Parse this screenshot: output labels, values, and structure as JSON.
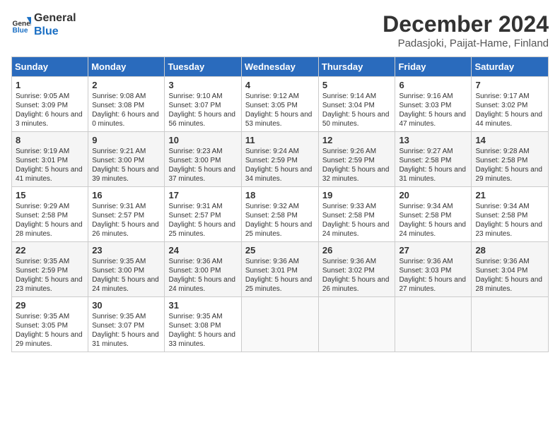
{
  "header": {
    "logo_line1": "General",
    "logo_line2": "Blue",
    "title": "December 2024",
    "subtitle": "Padasjoki, Paijat-Hame, Finland"
  },
  "weekdays": [
    "Sunday",
    "Monday",
    "Tuesday",
    "Wednesday",
    "Thursday",
    "Friday",
    "Saturday"
  ],
  "weeks": [
    [
      {
        "day": "1",
        "info": "Sunrise: 9:05 AM\nSunset: 3:09 PM\nDaylight: 6 hours and 3 minutes."
      },
      {
        "day": "2",
        "info": "Sunrise: 9:08 AM\nSunset: 3:08 PM\nDaylight: 6 hours and 0 minutes."
      },
      {
        "day": "3",
        "info": "Sunrise: 9:10 AM\nSunset: 3:07 PM\nDaylight: 5 hours and 56 minutes."
      },
      {
        "day": "4",
        "info": "Sunrise: 9:12 AM\nSunset: 3:05 PM\nDaylight: 5 hours and 53 minutes."
      },
      {
        "day": "5",
        "info": "Sunrise: 9:14 AM\nSunset: 3:04 PM\nDaylight: 5 hours and 50 minutes."
      },
      {
        "day": "6",
        "info": "Sunrise: 9:16 AM\nSunset: 3:03 PM\nDaylight: 5 hours and 47 minutes."
      },
      {
        "day": "7",
        "info": "Sunrise: 9:17 AM\nSunset: 3:02 PM\nDaylight: 5 hours and 44 minutes."
      }
    ],
    [
      {
        "day": "8",
        "info": "Sunrise: 9:19 AM\nSunset: 3:01 PM\nDaylight: 5 hours and 41 minutes."
      },
      {
        "day": "9",
        "info": "Sunrise: 9:21 AM\nSunset: 3:00 PM\nDaylight: 5 hours and 39 minutes."
      },
      {
        "day": "10",
        "info": "Sunrise: 9:23 AM\nSunset: 3:00 PM\nDaylight: 5 hours and 37 minutes."
      },
      {
        "day": "11",
        "info": "Sunrise: 9:24 AM\nSunset: 2:59 PM\nDaylight: 5 hours and 34 minutes."
      },
      {
        "day": "12",
        "info": "Sunrise: 9:26 AM\nSunset: 2:59 PM\nDaylight: 5 hours and 32 minutes."
      },
      {
        "day": "13",
        "info": "Sunrise: 9:27 AM\nSunset: 2:58 PM\nDaylight: 5 hours and 31 minutes."
      },
      {
        "day": "14",
        "info": "Sunrise: 9:28 AM\nSunset: 2:58 PM\nDaylight: 5 hours and 29 minutes."
      }
    ],
    [
      {
        "day": "15",
        "info": "Sunrise: 9:29 AM\nSunset: 2:58 PM\nDaylight: 5 hours and 28 minutes."
      },
      {
        "day": "16",
        "info": "Sunrise: 9:31 AM\nSunset: 2:57 PM\nDaylight: 5 hours and 26 minutes."
      },
      {
        "day": "17",
        "info": "Sunrise: 9:31 AM\nSunset: 2:57 PM\nDaylight: 5 hours and 25 minutes."
      },
      {
        "day": "18",
        "info": "Sunrise: 9:32 AM\nSunset: 2:58 PM\nDaylight: 5 hours and 25 minutes."
      },
      {
        "day": "19",
        "info": "Sunrise: 9:33 AM\nSunset: 2:58 PM\nDaylight: 5 hours and 24 minutes."
      },
      {
        "day": "20",
        "info": "Sunrise: 9:34 AM\nSunset: 2:58 PM\nDaylight: 5 hours and 24 minutes."
      },
      {
        "day": "21",
        "info": "Sunrise: 9:34 AM\nSunset: 2:58 PM\nDaylight: 5 hours and 23 minutes."
      }
    ],
    [
      {
        "day": "22",
        "info": "Sunrise: 9:35 AM\nSunset: 2:59 PM\nDaylight: 5 hours and 23 minutes."
      },
      {
        "day": "23",
        "info": "Sunrise: 9:35 AM\nSunset: 3:00 PM\nDaylight: 5 hours and 24 minutes."
      },
      {
        "day": "24",
        "info": "Sunrise: 9:36 AM\nSunset: 3:00 PM\nDaylight: 5 hours and 24 minutes."
      },
      {
        "day": "25",
        "info": "Sunrise: 9:36 AM\nSunset: 3:01 PM\nDaylight: 5 hours and 25 minutes."
      },
      {
        "day": "26",
        "info": "Sunrise: 9:36 AM\nSunset: 3:02 PM\nDaylight: 5 hours and 26 minutes."
      },
      {
        "day": "27",
        "info": "Sunrise: 9:36 AM\nSunset: 3:03 PM\nDaylight: 5 hours and 27 minutes."
      },
      {
        "day": "28",
        "info": "Sunrise: 9:36 AM\nSunset: 3:04 PM\nDaylight: 5 hours and 28 minutes."
      }
    ],
    [
      {
        "day": "29",
        "info": "Sunrise: 9:35 AM\nSunset: 3:05 PM\nDaylight: 5 hours and 29 minutes."
      },
      {
        "day": "30",
        "info": "Sunrise: 9:35 AM\nSunset: 3:07 PM\nDaylight: 5 hours and 31 minutes."
      },
      {
        "day": "31",
        "info": "Sunrise: 9:35 AM\nSunset: 3:08 PM\nDaylight: 5 hours and 33 minutes."
      },
      null,
      null,
      null,
      null
    ]
  ]
}
